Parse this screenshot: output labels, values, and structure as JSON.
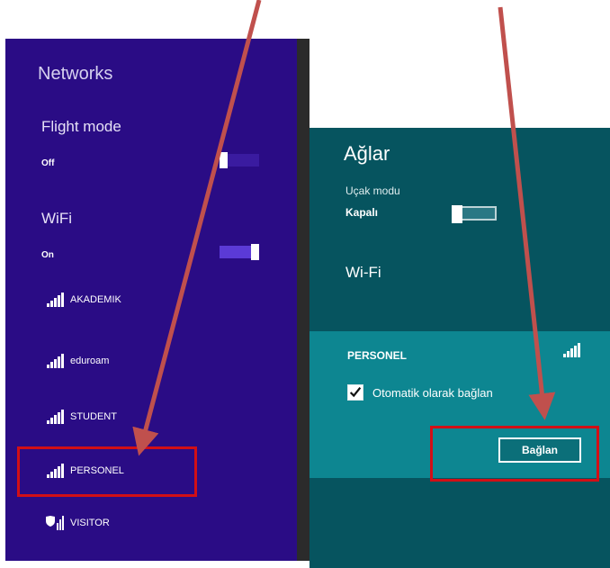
{
  "left": {
    "title": "Networks",
    "flight_mode_label": "Flight mode",
    "flight_mode_state": "Off",
    "wifi_label": "WiFi",
    "wifi_state": "On",
    "networks": [
      {
        "name": "AKADEMIK",
        "icon": "wifi-signal-icon"
      },
      {
        "name": "eduroam",
        "icon": "wifi-signal-icon"
      },
      {
        "name": "STUDENT",
        "icon": "wifi-signal-icon"
      },
      {
        "name": "PERSONEL",
        "icon": "wifi-signal-icon"
      },
      {
        "name": "VISITOR",
        "icon": "wifi-signal-shield-icon"
      }
    ]
  },
  "right": {
    "title": "Ağlar",
    "flight_mode_label": "Uçak modu",
    "flight_mode_state": "Kapalı",
    "wifi_label": "Wi-Fi",
    "selected_network": "PERSONEL",
    "auto_connect_label": "Otomatik olarak bağlan",
    "auto_connect_checked": true,
    "connect_button": "Bağlan"
  },
  "colors": {
    "left_panel_bg": "#2a0c85",
    "right_panel_bg": "#06545f",
    "right_selected_bg": "#0d8691",
    "highlight": "#d20f16",
    "arrow": "#c0504d"
  }
}
